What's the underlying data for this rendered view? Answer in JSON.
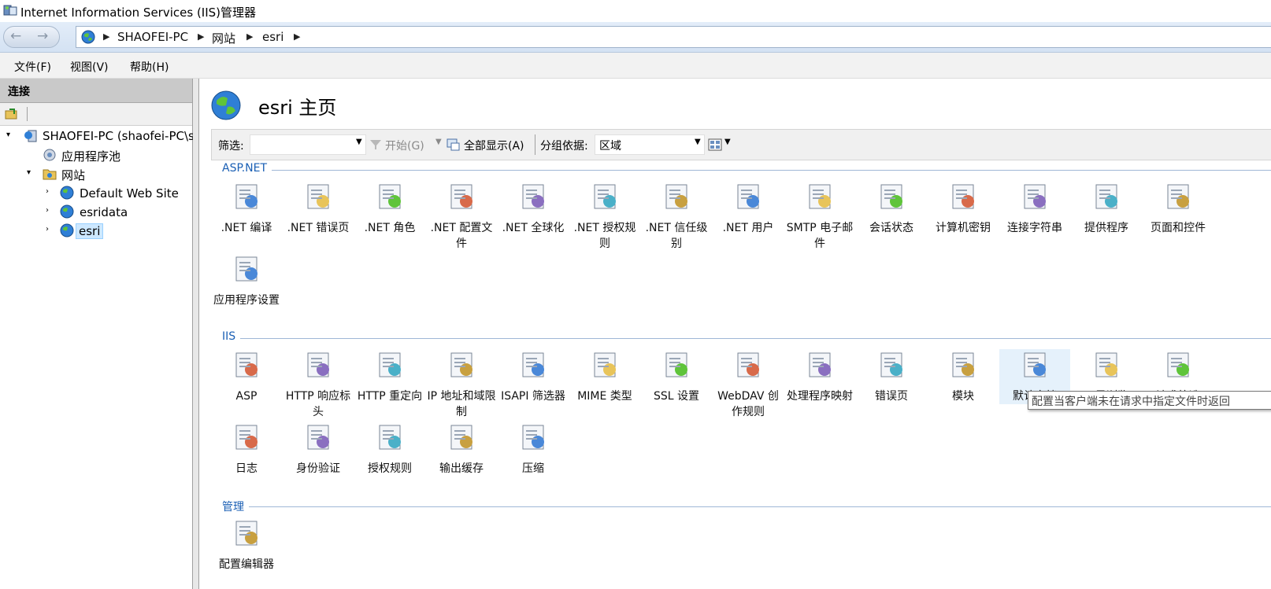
{
  "window": {
    "title": "Internet Information Services (IIS)管理器"
  },
  "address": {
    "crumbs": [
      "SHAOFEI-PC",
      "网站",
      "esri"
    ]
  },
  "menu": [
    "文件(F)",
    "视图(V)",
    "帮助(H)"
  ],
  "connections": {
    "header": "连接",
    "tree": [
      {
        "label": "SHAOFEI-PC (shaofei-PC\\sh"
      },
      {
        "label": "应用程序池"
      },
      {
        "label": "网站"
      },
      {
        "label": "Default Web Site"
      },
      {
        "label": "esridata"
      },
      {
        "label": "esri"
      }
    ]
  },
  "main": {
    "title": "esri 主页",
    "filter": {
      "label": "筛选:",
      "start": "开始(G)",
      "show_all": "全部显示(A)",
      "group_label": "分组依据:",
      "group_value": "区域"
    },
    "sections": [
      {
        "name": "ASP.NET",
        "items": [
          {
            "label": ".NET 编译",
            "icon": "net-compilation-icon"
          },
          {
            "label": ".NET 错误页",
            "icon": "net-error-pages-icon"
          },
          {
            "label": ".NET 角色",
            "icon": "net-roles-icon"
          },
          {
            "label": ".NET 配置文件",
            "icon": "net-profile-icon"
          },
          {
            "label": ".NET 全球化",
            "icon": "net-globalization-icon"
          },
          {
            "label": ".NET 授权规则",
            "icon": "net-authorization-icon"
          },
          {
            "label": ".NET 信任级别",
            "icon": "net-trust-levels-icon"
          },
          {
            "label": ".NET 用户",
            "icon": "net-users-icon"
          },
          {
            "label": "SMTP 电子邮件",
            "icon": "smtp-email-icon"
          },
          {
            "label": "会话状态",
            "icon": "session-state-icon"
          },
          {
            "label": "计算机密钥",
            "icon": "machine-key-icon"
          },
          {
            "label": "连接字符串",
            "icon": "connection-strings-icon"
          },
          {
            "label": "提供程序",
            "icon": "providers-icon"
          },
          {
            "label": "页面和控件",
            "icon": "pages-controls-icon"
          },
          {
            "label": "应用程序设置",
            "icon": "app-settings-icon"
          }
        ]
      },
      {
        "name": "IIS",
        "items": [
          {
            "label": "ASP",
            "icon": "asp-icon"
          },
          {
            "label": "HTTP 响应标头",
            "icon": "http-response-headers-icon"
          },
          {
            "label": "HTTP 重定向",
            "icon": "http-redirect-icon"
          },
          {
            "label": "IP 地址和域限制",
            "icon": "ip-restrictions-icon"
          },
          {
            "label": "ISAPI 筛选器",
            "icon": "isapi-filters-icon"
          },
          {
            "label": "MIME 类型",
            "icon": "mime-types-icon"
          },
          {
            "label": "SSL 设置",
            "icon": "ssl-settings-icon"
          },
          {
            "label": "WebDAV 创作规则",
            "icon": "webdav-icon"
          },
          {
            "label": "处理程序映射",
            "icon": "handler-mappings-icon"
          },
          {
            "label": "错误页",
            "icon": "error-pages-icon"
          },
          {
            "label": "模块",
            "icon": "modules-icon"
          },
          {
            "label": "默认文档",
            "icon": "default-document-icon"
          },
          {
            "label": "目录浏览",
            "icon": "directory-browsing-icon"
          },
          {
            "label": "请求筛选",
            "icon": "request-filtering-icon"
          },
          {
            "label": "日志",
            "icon": "logging-icon"
          },
          {
            "label": "身份验证",
            "icon": "authentication-icon"
          },
          {
            "label": "授权规则",
            "icon": "authorization-rules-icon"
          },
          {
            "label": "输出缓存",
            "icon": "output-caching-icon"
          },
          {
            "label": "压缩",
            "icon": "compression-icon"
          }
        ]
      },
      {
        "name": "管理",
        "items": [
          {
            "label": "配置编辑器",
            "icon": "config-editor-icon"
          }
        ]
      }
    ],
    "tooltip": "配置当客户端未在请求中指定文件时返回"
  }
}
